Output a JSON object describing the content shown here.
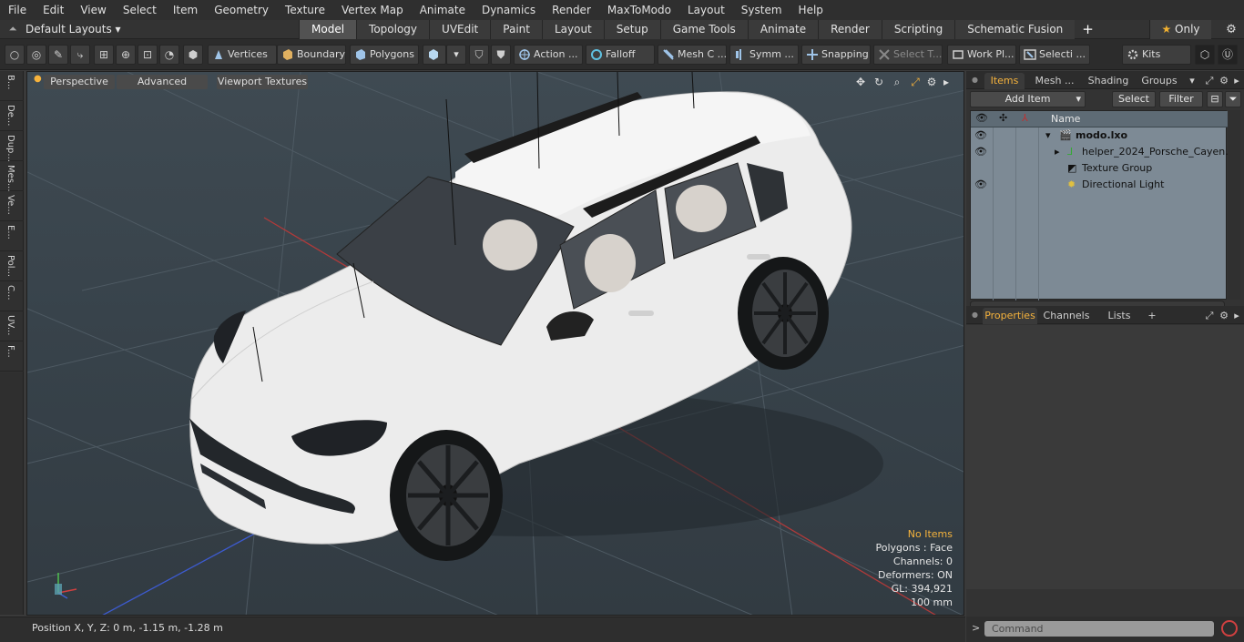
{
  "menu": [
    "File",
    "Edit",
    "View",
    "Select",
    "Item",
    "Geometry",
    "Texture",
    "Vertex Map",
    "Animate",
    "Dynamics",
    "Render",
    "MaxToModo",
    "Layout",
    "System",
    "Help"
  ],
  "layout": {
    "selector": "Default Layouts ▾",
    "tabs": [
      "Model",
      "Topology",
      "UVEdit",
      "Paint",
      "Layout",
      "Setup",
      "Game Tools",
      "Animate",
      "Render",
      "Scripting",
      "Schematic Fusion"
    ],
    "active_tab": "Model",
    "only_label": "Only"
  },
  "toolbar": {
    "vertices": "Vertices",
    "boundary": "Boundary",
    "polygons": "Polygons",
    "action": "Action",
    "falloff": "Falloff",
    "mesh": "Mesh C ...",
    "symm": "Symm ...",
    "snapping": "Snapping",
    "select_t": "Select T...",
    "work_pl": "Work Pl...",
    "selecti": "Selecti ...",
    "kits": "Kits"
  },
  "left_tabs": [
    "B...",
    "De...",
    "Dup...",
    "Mes...",
    "Ve...",
    "E...",
    "Pol...",
    "C...",
    "UV...",
    "F..."
  ],
  "viewport": {
    "perspective": "Perspective",
    "advanced": "Advanced",
    "viewport_textures": "Viewport Textures",
    "stats": {
      "no_items": "No Items",
      "polygons": "Polygons : Face",
      "channels": "Channels: 0",
      "deformers": "Deformers: ON",
      "gl": "GL: 394,921",
      "scale": "100 mm"
    }
  },
  "status": {
    "position": "Position X, Y, Z:   0 m, -1.15 m, -1.28 m"
  },
  "items_panel": {
    "tabs": [
      "Items",
      "Mesh ...",
      "Shading",
      "Groups"
    ],
    "active_tab": "Items",
    "add_item": "Add Item",
    "select": "Select",
    "filter": "Filter",
    "name_col": "Name",
    "tree": [
      {
        "label": "modo.lxo"
      },
      {
        "label": "helper_2024_Porsche_Cayen..."
      },
      {
        "label": "Texture Group"
      },
      {
        "label": "Directional Light"
      }
    ]
  },
  "props_panel": {
    "tabs": [
      "Properties",
      "Channels",
      "Lists"
    ],
    "active_tab": "Properties"
  },
  "command": {
    "placeholder": "Command"
  },
  "colors": {
    "accent": "#f5b23c",
    "tree_bg": "#7d8a95",
    "car_body": "#ececec"
  }
}
